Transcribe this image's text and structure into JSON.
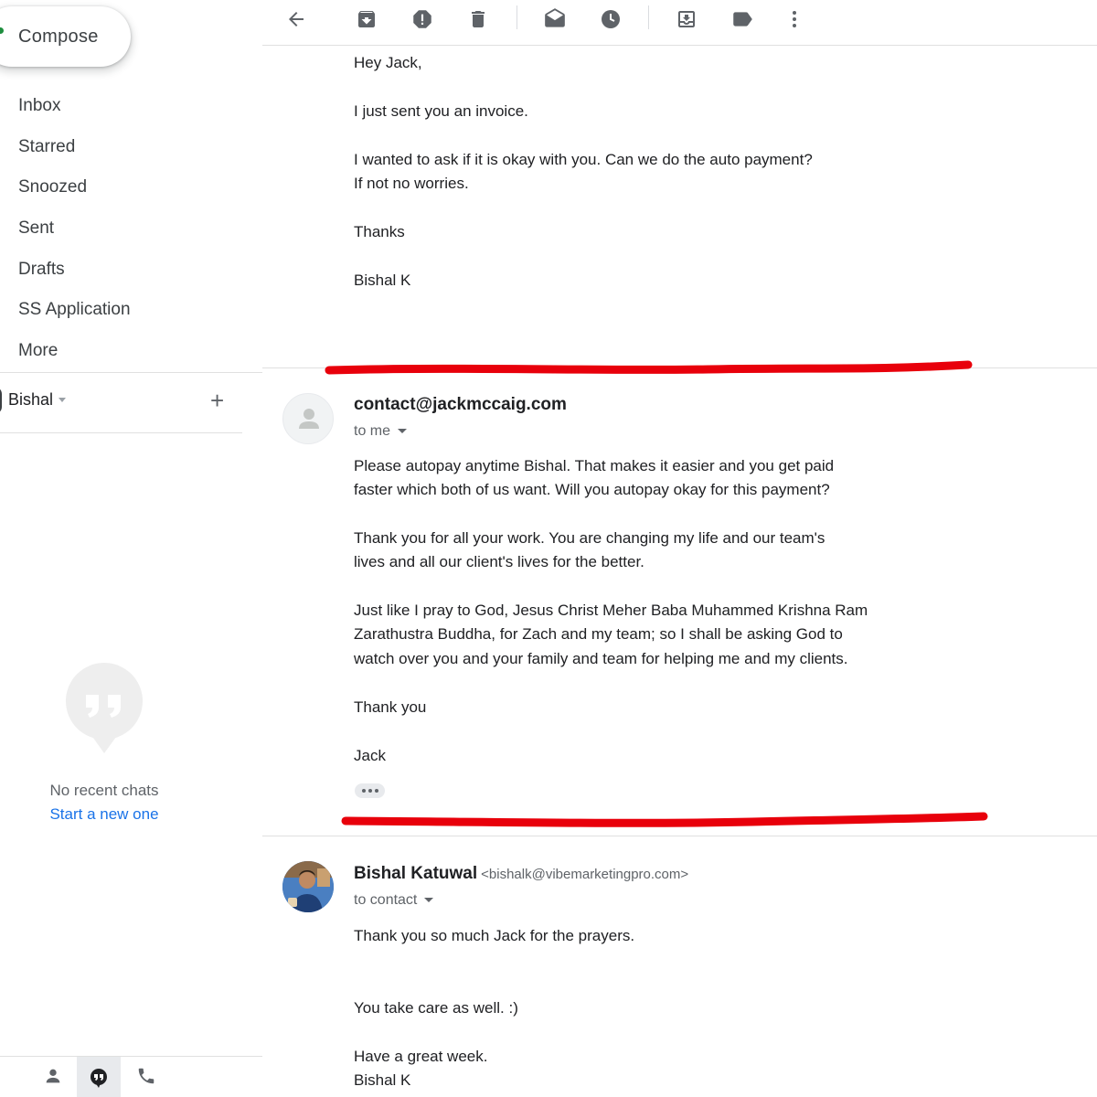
{
  "sidebar": {
    "compose_label": "Compose",
    "items": [
      {
        "label": "Inbox"
      },
      {
        "label": "Starred"
      },
      {
        "label": "Snoozed"
      },
      {
        "label": "Sent"
      },
      {
        "label": "Drafts"
      },
      {
        "label": "SS Application"
      },
      {
        "label": "More"
      }
    ],
    "user": {
      "name": "Bishal",
      "status_color": "#1e8e3e"
    },
    "chats": {
      "empty_text": "No recent chats",
      "start_link": "Start a new one"
    }
  },
  "toolbar": {
    "icons": [
      "back-arrow-icon",
      "archive-icon",
      "report-spam-icon",
      "delete-icon",
      "mark-unread-icon",
      "snooze-icon",
      "move-to-icon",
      "label-icon",
      "more-vert-icon"
    ]
  },
  "messages": [
    {
      "body_lines": [
        "Hey Jack,",
        "I just sent you an invoice.",
        "I wanted to ask if it is okay with you. Can we do the auto payment?",
        "If not no worries.",
        "Thanks",
        "Bishal K"
      ]
    },
    {
      "sender": "contact@jackmccaig.com",
      "to": "to me",
      "body_lines": [
        "Please autopay anytime Bishal.  That makes it easier and you get paid",
        "faster which both of us want.  Will you autopay okay for this payment?",
        "Thank you for all your work.  You are changing my life and our team's",
        "lives and all our client's lives for the better.",
        "Just like I pray to God, Jesus Christ Meher Baba Muhammed Krishna Ram",
        "Zarathustra Buddha, for Zach and my team; so I shall be asking God to",
        "watch over you and your family and team for helping me and my clients.",
        "Thank you",
        "Jack"
      ]
    },
    {
      "sender": "Bishal Katuwal",
      "sender_email": "<bishalk@vibemarketingpro.com>",
      "to": "to contact",
      "body_lines": [
        "Thank you so much Jack for the prayers.",
        "You take care as well. :)",
        "Have a great week.",
        "Bishal K"
      ]
    }
  ],
  "colors": {
    "accent_link": "#1a73e8",
    "annotation_red": "#e8000b"
  }
}
